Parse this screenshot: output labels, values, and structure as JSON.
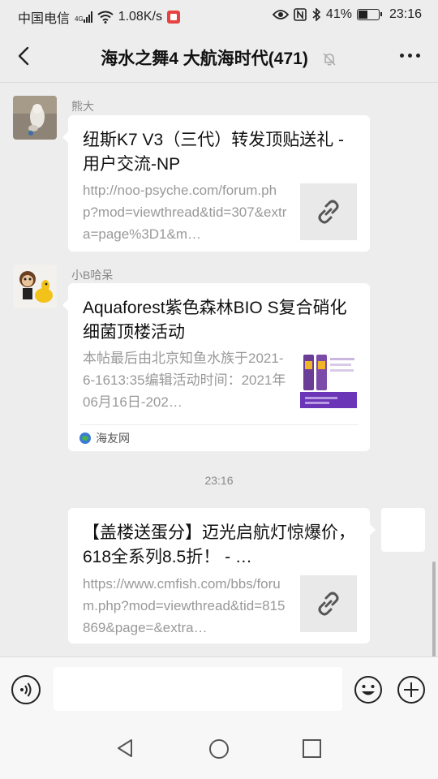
{
  "status_bar": {
    "carrier": "中国电信",
    "network_tag": "4G",
    "speed": "1.08K/s",
    "battery": "41%",
    "time": "23:16"
  },
  "header": {
    "title": "海水之舞4 大航海时代(471)"
  },
  "messages": [
    {
      "sender": "熊大",
      "title": "纽斯K7 V3（三代）转发顶贴送礼 - 用户交流-NP",
      "desc": "http://noo-psyche.com/forum.php?mod=viewthread&tid=307&extra=page%3D1&m…",
      "thumb": "link-icon"
    },
    {
      "sender": "小B哈呆",
      "title": "Aquaforest紫色森林BIO S复合硝化细菌顶楼活动",
      "desc": "本帖最后由北京知鱼水族于2021-6-1613:35编辑活动时间：2021年06月16日-202…",
      "thumb": "product-image",
      "source": "海友网"
    },
    {
      "title": "【盖楼送蛋分】迈光启航灯惊爆价，618全系列8.5折！ - …",
      "desc": "https://www.cmfish.com/bbs/forum.php?mod=viewthread&tid=815869&page=&extra…",
      "thumb": "link-icon"
    }
  ],
  "timestamp": "23:16",
  "input": {
    "value": "",
    "placeholder": ""
  },
  "colors": {
    "background": "#ededed",
    "card": "#ffffff",
    "recording": "#e64340"
  }
}
